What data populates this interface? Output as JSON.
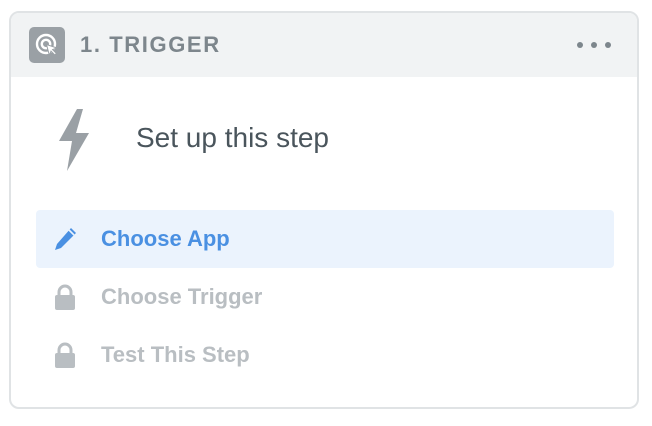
{
  "header": {
    "title": "1. TRIGGER",
    "icon": "trigger-cursor-icon",
    "more_icon": "more-horizontal-icon"
  },
  "main": {
    "icon": "lightning-bolt-icon",
    "title": "Set up this step"
  },
  "steps": [
    {
      "label": "Choose App",
      "icon": "pencil-icon",
      "state": "active"
    },
    {
      "label": "Choose Trigger",
      "icon": "lock-icon",
      "state": "locked"
    },
    {
      "label": "Test This Step",
      "icon": "lock-icon",
      "state": "locked"
    }
  ],
  "colors": {
    "accent": "#4a90e2",
    "active_bg": "#ebf3fd",
    "header_bg": "#f1f3f4",
    "muted": "#b9bec2",
    "header_text": "#7d868c",
    "title_text": "#4a555c"
  }
}
